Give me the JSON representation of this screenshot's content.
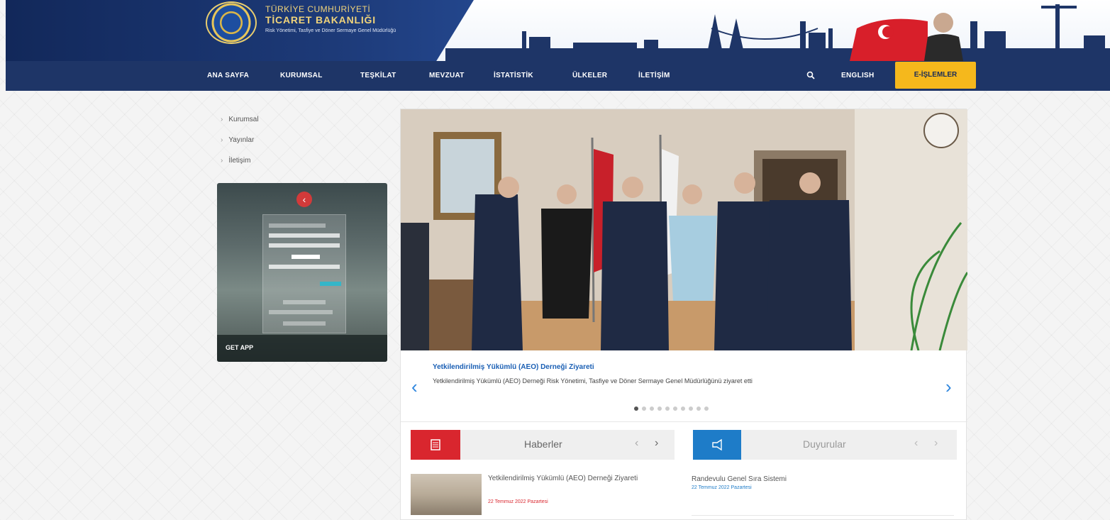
{
  "header": {
    "logo_line1": "TÜRKİYE CUMHURİYETİ",
    "logo_line2": "TİCARET BAKANLIĞI",
    "logo_line3": "Risk Yönetimi, Tasfiye ve Döner Sermaye Genel Müdürlüğü"
  },
  "nav": {
    "items": [
      "ANA SAYFA",
      "KURUMSAL",
      "TEŞKİLAT",
      "MEVZUAT",
      "İSTATİSTİK",
      "ÜLKELER",
      "İLETİŞİM"
    ],
    "english": "ENGLISH",
    "eislemler": "E-İŞLEMLER",
    "search_icon": "search-icon"
  },
  "sidebar": {
    "links": [
      "Kurumsal",
      "Yayınlar",
      "İletişim"
    ],
    "app_label": "GET APP"
  },
  "slider": {
    "title": "Yetkilendirilmiş Yükümlü (AEO) Derneği Ziyareti",
    "text": "Yetkilendirilmiş Yükümlü (AEO) Derneği Risk Yönetimi, Tasfiye ve Döner Sermaye Genel Müdürlüğünü ziyaret etti",
    "prev": "‹",
    "next": "›",
    "dot_count": 10,
    "active_dot": 0
  },
  "news": {
    "tab_title": "Haberler",
    "prev": "‹",
    "next": "›",
    "item_title": "Yetkilendirilmiş Yükümlü (AEO) Derneği Ziyareti",
    "item_date": "22 Temmuz 2022 Pazartesi",
    "accent": "#d9262e"
  },
  "announcements": {
    "tab_title": "Duyurular",
    "prev": "‹",
    "next": "›",
    "item_title": "Randevulu Genel Sıra Sistemi",
    "item_date": "22 Temmuz 2022 Pazartesi",
    "accent": "#1e7cc8"
  },
  "colors": {
    "nav_bg": "#1e3567",
    "eislem_bg": "#f5b81c"
  }
}
